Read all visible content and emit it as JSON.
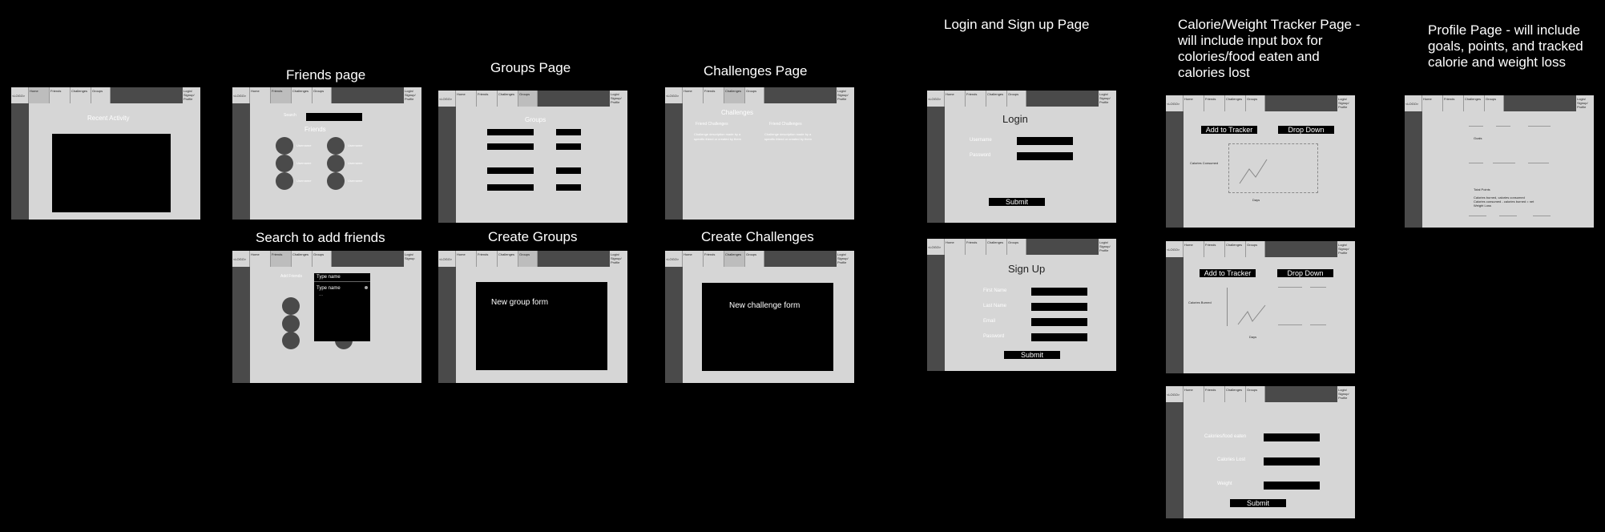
{
  "headings": {
    "friends": "Friends page",
    "groups": "Groups Page",
    "challenges": "Challenges Page",
    "login_signup": "Login and Sign up Page",
    "tracker": "Calorie/Weight Tracker Page - will include input box for colories/food eaten and calories lost",
    "profile": "Profile Page - will include goals, points, and tracked calorie and weight loss",
    "search_friends": "Search to add friends",
    "create_groups": "Create Groups",
    "create_challenges": "Create Challenges"
  },
  "nav": {
    "logo": "<LOGO>",
    "home": "Home",
    "friends": "Friends",
    "challenges": "Challenges",
    "groups": "Groups",
    "auth": "Login/ Signup/ Profile",
    "auth_short": "Login/ Signup"
  },
  "home": {
    "recent_activity": "Recent Activity"
  },
  "friends_page": {
    "search_label": "Search",
    "title": "Friends",
    "friend_label": "Username"
  },
  "groups_page": {
    "title": "Groups"
  },
  "challenges_page": {
    "title": "Challenges",
    "col1_title": "Friend Challenges",
    "col2_title": "Friend Challenges",
    "desc": "Challenge description made by a specific friend or created by them"
  },
  "search_page": {
    "label": "Add Friends",
    "popup_title": "Type name",
    "popup_input": "Type name",
    "popup_hint": "..."
  },
  "create_group": {
    "form": "New group form"
  },
  "create_challenge": {
    "form": "New challenge form"
  },
  "login": {
    "title": "Login",
    "username": "Username",
    "password": "Password",
    "submit": "Submit"
  },
  "signup": {
    "title": "Sign Up",
    "first_name": "First Name",
    "last_name": "Last Name",
    "email": "Email",
    "password": "Password",
    "submit": "Submit"
  },
  "tracker1": {
    "add": "Add to Tracker",
    "drop": "Drop Down",
    "y_label": "Calories Consumed",
    "x_label": "Days"
  },
  "tracker2": {
    "add": "Add to Tracker",
    "drop": "Drop Down",
    "y_label": "Calories Burned",
    "x_label": "Days"
  },
  "tracker3": {
    "eaten": "Calories/food eaten",
    "lost": "Calories Lost",
    "weight": "Weight",
    "submit": "Submit"
  },
  "profile": {
    "goals": "Goals",
    "points": "Total Points",
    "line1": "Calories burned, calories consumed",
    "line2": "Calories consumed - calories burned = net",
    "line3": "Weight Loss"
  }
}
